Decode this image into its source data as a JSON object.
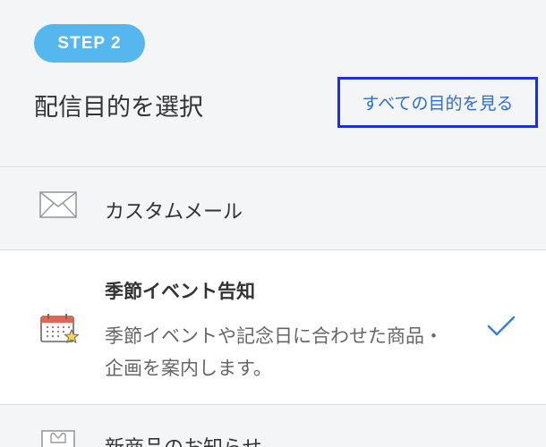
{
  "header": {
    "step_label": "STEP 2",
    "title": "配信目的を選択",
    "see_all_label": "すべての目的を見る"
  },
  "options": [
    {
      "icon": "envelope-icon",
      "label": "カスタムメール",
      "selected": false
    },
    {
      "icon": "calendar-star-icon",
      "title": "季節イベント告知",
      "description": "季節イベントや記念日に合わせた商品・企画を案内します。",
      "selected": true
    },
    {
      "icon": "gift-box-icon",
      "label": "新商品のお知らせ",
      "selected": false
    }
  ],
  "colors": {
    "accent": "#55b7ee",
    "link": "#2d6ecf",
    "focus_outline": "#1d2fd6",
    "check": "#3b7fd9"
  }
}
